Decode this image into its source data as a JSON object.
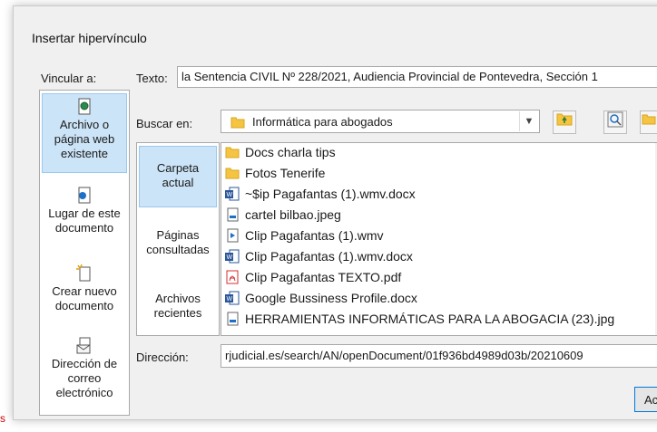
{
  "dialog": {
    "title": "Insertar hipervínculo",
    "link_label": "Vincular a:",
    "text_label": "Texto:",
    "text_value": "la Sentencia CIVIL Nº 228/2021, Audiencia Provincial de Pontevedra, Sección 1"
  },
  "left_nav": {
    "items": [
      {
        "label": "Archivo o página web existente",
        "icon": "file-web-icon",
        "selected": true
      },
      {
        "label": "Lugar de este documento",
        "icon": "document-place-icon",
        "selected": false
      },
      {
        "label": "Crear nuevo documento",
        "icon": "new-document-icon",
        "selected": false
      },
      {
        "label": "Dirección de correo electrónico",
        "icon": "email-icon",
        "selected": false
      }
    ]
  },
  "search": {
    "label": "Buscar en:",
    "value": "Informática para abogados"
  },
  "sub_nav": {
    "items": [
      {
        "label": "Carpeta actual",
        "selected": true
      },
      {
        "label": "Páginas consultadas",
        "selected": false
      },
      {
        "label": "Archivos recientes",
        "selected": false
      }
    ]
  },
  "files": [
    {
      "name": "Docs charla tips",
      "icon": "folder-icon"
    },
    {
      "name": "Fotos Tenerife",
      "icon": "folder-icon"
    },
    {
      "name": "~$ip Pagafantas (1).wmv.docx",
      "icon": "word-icon"
    },
    {
      "name": "cartel bilbao.jpeg",
      "icon": "image-file-icon"
    },
    {
      "name": "Clip Pagafantas (1).wmv",
      "icon": "video-file-icon"
    },
    {
      "name": "Clip Pagafantas (1).wmv.docx",
      "icon": "word-icon"
    },
    {
      "name": "Clip Pagafantas TEXTO.pdf",
      "icon": "pdf-icon"
    },
    {
      "name": "Google Bussiness Profile.docx",
      "icon": "word-icon"
    },
    {
      "name": "HERRAMIENTAS INFORMÁTICAS PARA LA ABOGACIA (23).jpg",
      "icon": "image-file-icon"
    }
  ],
  "address": {
    "label": "Dirección:",
    "value": "rjudicial.es/search/AN/openDocument/01f936bd4989d03b/20210609"
  },
  "ok_button": "Ac",
  "edge_letter": "s",
  "colors": {
    "selected_bg": "#cce4f7",
    "selected_border": "#99c9ef",
    "dialog_bg": "#f0f0f0"
  }
}
